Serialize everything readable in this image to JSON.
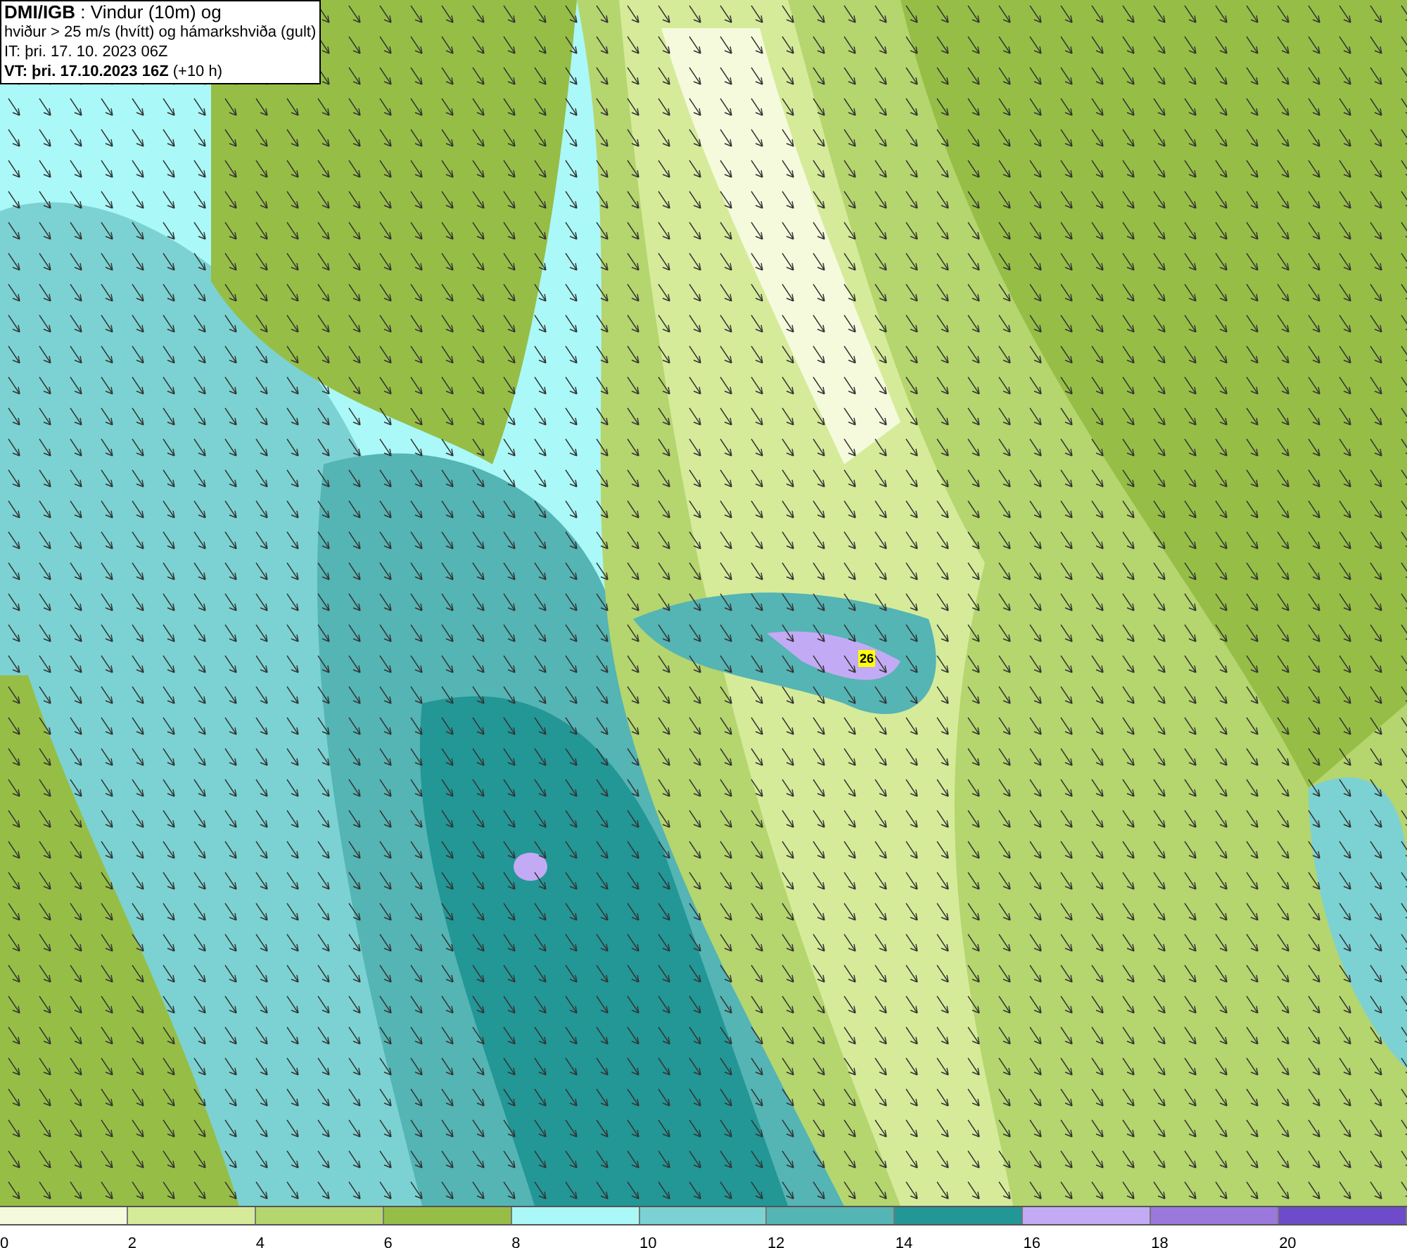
{
  "header": {
    "lines": [
      "**DMI/IGB** : Vindur (10m) og",
      "hviður > 25 m/s (hvítt) og hámarkshviða (gult)",
      "IT: þri. 17. 10. 2023 06Z",
      "**VT: þri. 17.10.2023 16Z** (+10 h)"
    ]
  },
  "map": {
    "gust_label": "26"
  },
  "legend": [
    {
      "label": "0",
      "color": "#f5fadc"
    },
    {
      "label": "2",
      "color": "#d5eb9a"
    },
    {
      "label": "4",
      "color": "#b5d56e"
    },
    {
      "label": "6",
      "color": "#96be46"
    },
    {
      "label": "8",
      "color": "#aaf8f8"
    },
    {
      "label": "10",
      "color": "#7cd2d2"
    },
    {
      "label": "12",
      "color": "#55b4b4"
    },
    {
      "label": "14",
      "color": "#239696"
    },
    {
      "label": "16",
      "color": "#c3aaf5"
    },
    {
      "label": "18",
      "color": "#9b78dc"
    },
    {
      "label": "20",
      "color": "#6e4bc8"
    }
  ]
}
